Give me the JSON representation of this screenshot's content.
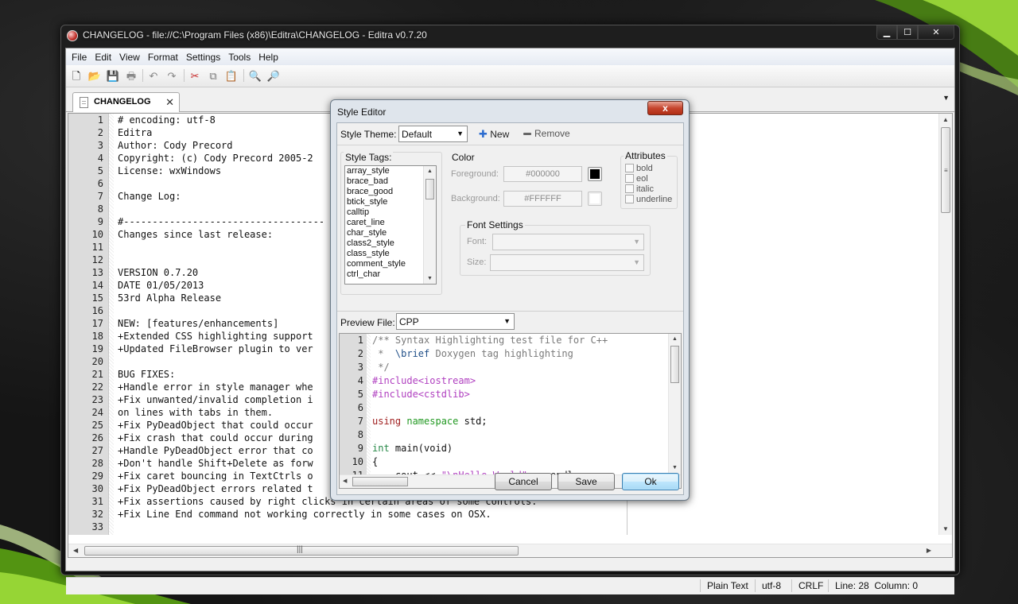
{
  "window": {
    "title": "CHANGELOG - file://C:\\Program Files (x86)\\Editra\\CHANGELOG - Editra v0.7.20",
    "controls": {
      "minimize": "▁",
      "maximize": "☐",
      "close": "✕"
    }
  },
  "menubar": [
    "File",
    "Edit",
    "View",
    "Format",
    "Settings",
    "Tools",
    "Help"
  ],
  "toolbar": {
    "icons": [
      "new-file-icon",
      "open-folder-icon",
      "save-icon",
      "print-icon",
      "undo-icon",
      "redo-icon",
      "cut-icon",
      "copy-icon",
      "paste-icon",
      "find-icon",
      "find-replace-icon"
    ],
    "glyphs": [
      "🗋",
      "📂",
      "💾",
      "🖶",
      "↶",
      "↷",
      "✂",
      "⧉",
      "📋",
      "🔍",
      "🔎"
    ]
  },
  "tab": {
    "label": "CHANGELOG",
    "close": "✕",
    "menu_arrow": "▼"
  },
  "editor": {
    "line_numbers": [
      "1",
      "2",
      "3",
      "4",
      "5",
      "6",
      "7",
      "8",
      "9",
      "10",
      "11",
      "12",
      "13",
      "14",
      "15",
      "16",
      "17",
      "18",
      "19",
      "20",
      "21",
      "22",
      "23",
      "24",
      "25",
      "26",
      "27",
      "28",
      "29",
      "30",
      "31",
      "32",
      "33"
    ],
    "lines": [
      "# encoding: utf-8",
      "Editra",
      "Author: Cody Precord",
      "Copyright: (c) Cody Precord 2005-2",
      "License: wxWindows",
      "",
      "Change Log:",
      "",
      "#-----------------------------------",
      "Changes since last release:",
      "",
      "",
      "VERSION 0.7.20",
      "DATE 01/05/2013",
      "53rd Alpha Release",
      "",
      "NEW: [features/enhancements]",
      "+Extended CSS highlighting support",
      "+Updated FileBrowser plugin to ver",
      "",
      "BUG FIXES:",
      "+Handle error in style manager whe",
      "+Fix unwanted/invalid completion i",
      "on lines with tabs in them.",
      "+Fix PyDeadObject that could occur",
      "+Fix crash that could occur during",
      "+Handle PyDeadObject error that co",
      "+Don't handle Shift+Delete as forw",
      "+Fix caret bouncing in TextCtrls o",
      "+Fix PyDeadObject errors related t",
      "+Fix assertions caused by right clicks in certain areas of some controls.",
      "+Fix Line End command not working correctly in some cases on OSX.",
      ""
    ],
    "partial_line": "#",
    "scroll_grip": "≡",
    "hscroll_grip": "|||",
    "arrows": {
      "up": "▲",
      "down": "▼",
      "left": "◀",
      "right": "▶"
    }
  },
  "statusbar": {
    "syntax": "Plain Text",
    "encoding": "utf-8",
    "eol": "CRLF",
    "position": "Line: 28  Column: 0"
  },
  "style_editor": {
    "title": "Style Editor",
    "close": "x",
    "theme_label": "Style Theme:",
    "theme_value": "Default",
    "new_label": "New",
    "remove_label": "Remove",
    "style_tags_label": "Style Tags:",
    "style_tags": [
      "array_style",
      "brace_bad",
      "brace_good",
      "btick_style",
      "calltip",
      "caret_line",
      "char_style",
      "class2_style",
      "class_style",
      "comment_style",
      "ctrl_char"
    ],
    "color_group": "Color",
    "foreground_label": "Foreground:",
    "foreground_value": "#000000",
    "foreground_color": "#000000",
    "background_label": "Background:",
    "background_value": "#FFFFFF",
    "background_color": "#FFFFFF",
    "attributes_group": "Attributes",
    "attributes": [
      "bold",
      "eol",
      "italic",
      "underline"
    ],
    "font_settings_group": "Font Settings",
    "font_label": "Font:",
    "size_label": "Size:",
    "preview_label": "Preview File:",
    "preview_value": "CPP",
    "preview_line_numbers": [
      "1",
      "2",
      "3",
      "4",
      "5",
      "6",
      "7",
      "8",
      "9",
      "10",
      "11"
    ],
    "preview_lines": [
      [
        {
          "t": "/** Syntax Highlighting test file for C++",
          "c": "c-comment"
        }
      ],
      [
        {
          "t": " *  ",
          "c": "c-comment"
        },
        {
          "t": "\\brief",
          "c": "c-doc"
        },
        {
          "t": " Doxygen tag highlighting",
          "c": "c-comment"
        }
      ],
      [
        {
          "t": " */",
          "c": "c-comment"
        }
      ],
      [
        {
          "t": "#include<iostream>",
          "c": "c-pre"
        }
      ],
      [
        {
          "t": "#include<cstdlib>",
          "c": "c-pre"
        }
      ],
      [
        {
          "t": "",
          "c": "c-plain"
        }
      ],
      [
        {
          "t": "using",
          "c": "c-kw"
        },
        {
          "t": " ",
          "c": "c-plain"
        },
        {
          "t": "namespace",
          "c": "c-kw2"
        },
        {
          "t": " std;",
          "c": "c-plain"
        }
      ],
      [
        {
          "t": "",
          "c": "c-plain"
        }
      ],
      [
        {
          "t": "int",
          "c": "c-type"
        },
        {
          "t": " main(void)",
          "c": "c-plain"
        }
      ],
      [
        {
          "t": "{",
          "c": "c-plain"
        }
      ],
      [
        {
          "t": "    cout << ",
          "c": "c-plain"
        },
        {
          "t": "\"\\nHello World\"",
          "c": "c-str"
        },
        {
          "t": " << endl;",
          "c": "c-plain"
        }
      ]
    ],
    "buttons": {
      "cancel": "Cancel",
      "save": "Save",
      "ok": "Ok"
    }
  },
  "colors": {
    "accent_green": "#7dc21e",
    "dialog_close_red": "#c6452e",
    "default_button_blue": "#3c7fb1"
  }
}
